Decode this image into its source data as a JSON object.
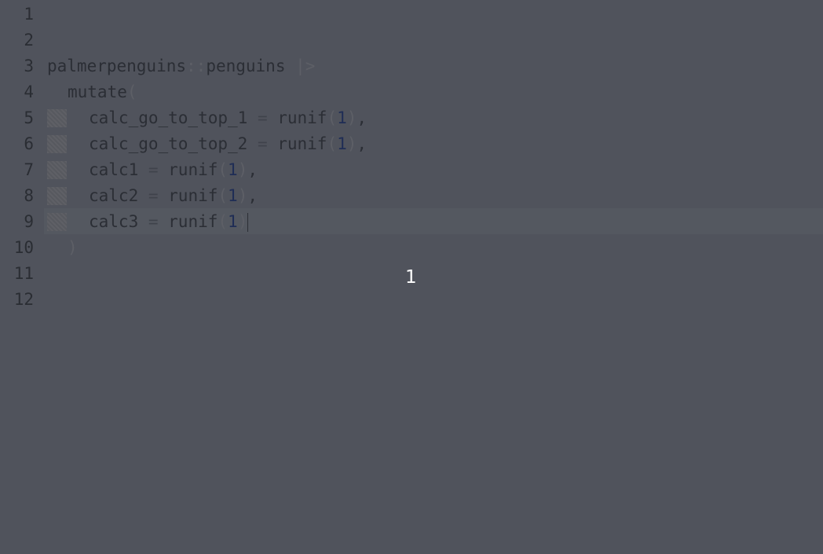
{
  "line_numbers": [
    "1",
    "2",
    "3",
    "4",
    "5",
    "6",
    "7",
    "8",
    "9",
    "10",
    "11",
    "12"
  ],
  "code": {
    "line3": {
      "text": "palmerpenguins",
      "ns_op": "::",
      "obj": "penguins",
      "pipe": " |>"
    },
    "line4": {
      "fn": "mutate",
      "open": "("
    },
    "line5": {
      "var": "calc_go_to_top_1",
      "eq": " = ",
      "fn": "runif",
      "open": "(",
      "num": "1",
      "close": ")",
      "comma": ","
    },
    "line6": {
      "var": "calc_go_to_top_2",
      "eq": " = ",
      "fn": "runif",
      "open": "(",
      "num": "1",
      "close": ")",
      "comma": ","
    },
    "line7": {
      "var": "calc1",
      "eq": " = ",
      "fn": "runif",
      "open": "(",
      "num": "1",
      "close": ")",
      "comma": ","
    },
    "line8": {
      "var": "calc2",
      "eq": " = ",
      "fn": "runif",
      "open": "(",
      "num": "1",
      "close": ")",
      "comma": ","
    },
    "line9": {
      "var": "calc3",
      "eq": " = ",
      "fn": "runif",
      "open": "(",
      "num": "1",
      "close": ")"
    },
    "line10": {
      "close": ")"
    }
  },
  "overlay": {
    "value": "1"
  }
}
